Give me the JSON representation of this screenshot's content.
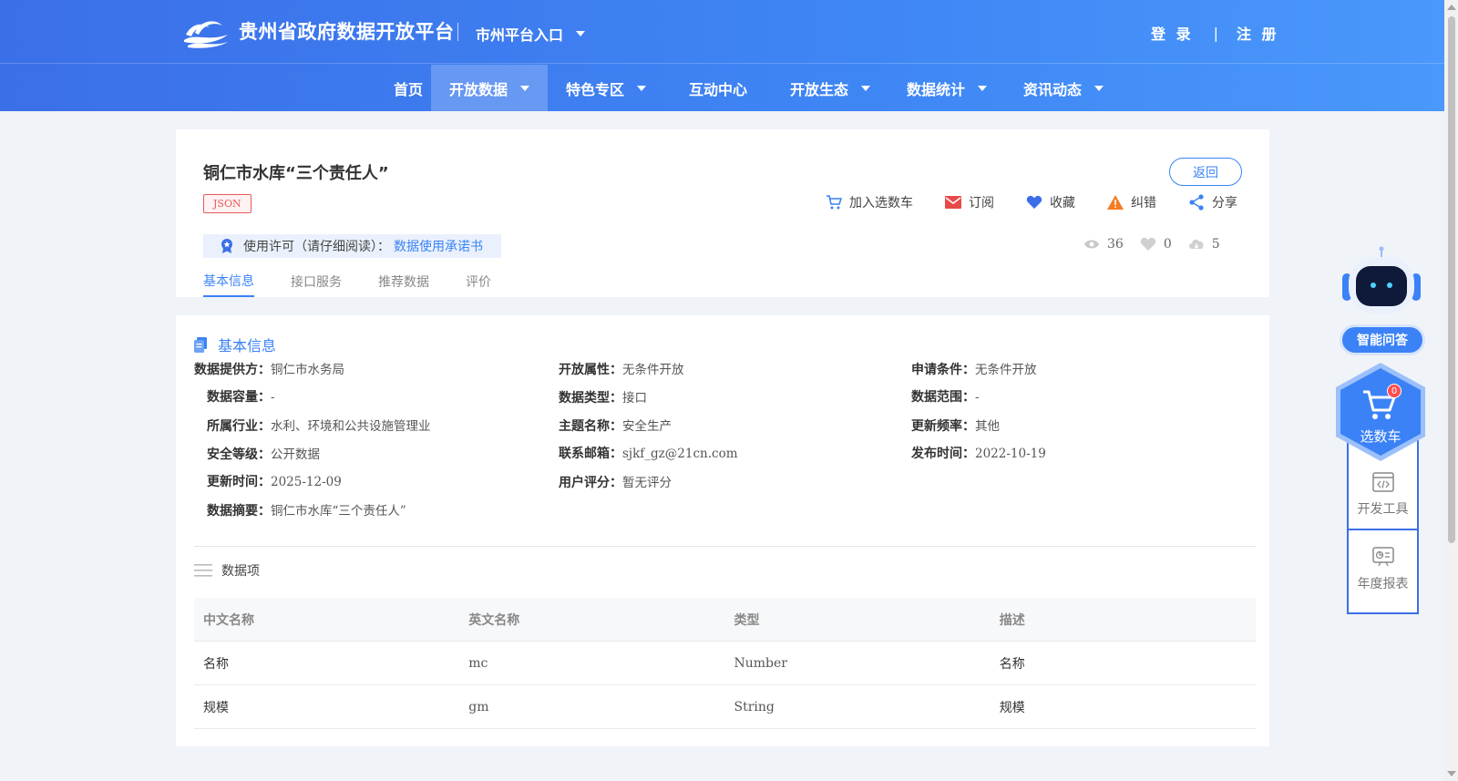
{
  "header": {
    "site_title": "贵州省政府数据开放平台",
    "city_entry": "市州平台入口",
    "login": "登 录",
    "separator": "|",
    "register": "注 册"
  },
  "nav": {
    "items": [
      {
        "label": "首页"
      },
      {
        "label": "开放数据"
      },
      {
        "label": "特色专区"
      },
      {
        "label": "互动中心"
      },
      {
        "label": "开放生态"
      },
      {
        "label": "数据统计"
      },
      {
        "label": "资讯动态"
      }
    ],
    "active": "开放数据"
  },
  "dataset": {
    "title": "铜仁市水库“三个责任人”",
    "format_badge": "JSON",
    "back_label": "返回",
    "actions": {
      "cart": "加入选数车",
      "subscribe": "订阅",
      "favorite": "收藏",
      "report": "纠错",
      "share": "分享"
    },
    "license_label": "使用许可（请仔细阅读）：",
    "license_link": "数据使用承诺书",
    "stats": {
      "views": "36",
      "likes": "0",
      "downloads": "5"
    },
    "tabs": [
      "基本信息",
      "接口服务",
      "推荐数据",
      "评价"
    ],
    "active_tab": "基本信息"
  },
  "basic_info": {
    "heading": "基本信息",
    "fields": {
      "provider": {
        "k": "数据提供方：",
        "v": "铜仁市水务局"
      },
      "open_attr": {
        "k": "开放属性：",
        "v": "无条件开放"
      },
      "apply_cond": {
        "k": "申请条件：",
        "v": "无条件开放"
      },
      "capacity": {
        "k": "数据容量：",
        "v": "-"
      },
      "data_type": {
        "k": "数据类型：",
        "v": "接口"
      },
      "data_scope": {
        "k": "数据范围：",
        "v": "-"
      },
      "industry": {
        "k": "所属行业：",
        "v": "水利、环境和公共设施管理业"
      },
      "theme": {
        "k": "主题名称：",
        "v": "安全生产"
      },
      "frequency": {
        "k": "更新频率：",
        "v": "其他"
      },
      "security": {
        "k": "安全等级：",
        "v": "公开数据"
      },
      "email": {
        "k": "联系邮箱：",
        "v": "sjkf_gz@21cn.com"
      },
      "publish_time": {
        "k": "发布时间：",
        "v": "2022-10-19"
      },
      "update_time": {
        "k": "更新时间：",
        "v": "2025-12-09"
      },
      "rating": {
        "k": "用户评分：",
        "v": "暂无评分"
      },
      "summary": {
        "k": "数据摘要：",
        "v": "铜仁市水库“三个责任人”"
      }
    }
  },
  "data_items": {
    "heading": "数据项",
    "columns": [
      "中文名称",
      "英文名称",
      "类型",
      "描述"
    ],
    "rows": [
      [
        "名称",
        "mc",
        "Number",
        "名称"
      ],
      [
        "规模",
        "gm",
        "String",
        "规模"
      ]
    ]
  },
  "floating": {
    "qa": "智能问答",
    "cart": "选数车",
    "cart_count": "0",
    "dev_tools": "开发工具",
    "annual_report": "年度报表"
  },
  "colors": {
    "primary": "#3b82f6",
    "header_start": "#3b6fe8",
    "header_end": "#4a98fb",
    "badge_red": "#e65a5a"
  }
}
